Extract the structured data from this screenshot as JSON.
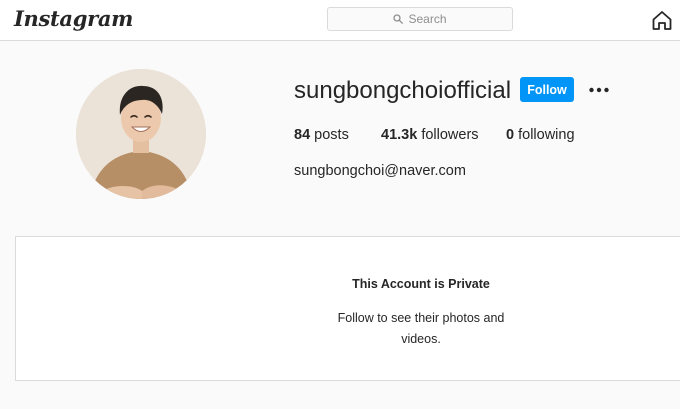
{
  "app": {
    "name": "Instagram"
  },
  "nav": {
    "logo_text": "Instagram",
    "search_placeholder": "Search",
    "home_icon": "home-icon",
    "search_icon": "search-icon"
  },
  "profile": {
    "username": "sungbongchoiofficial",
    "follow_label": "Follow",
    "more_icon": "more-options-icon",
    "stats": {
      "posts_count": "84",
      "posts_label": "posts",
      "followers_count": "41.3k",
      "followers_label": "followers",
      "following_count": "0",
      "following_label": "following"
    },
    "bio": "sungbongchoi@naver.com"
  },
  "private": {
    "title": "This Account is Private",
    "description": "Follow to see their photos and videos."
  },
  "colors": {
    "accent": "#0095f6",
    "background": "#fafafa",
    "border": "#dbdbdb",
    "text": "#262626"
  }
}
